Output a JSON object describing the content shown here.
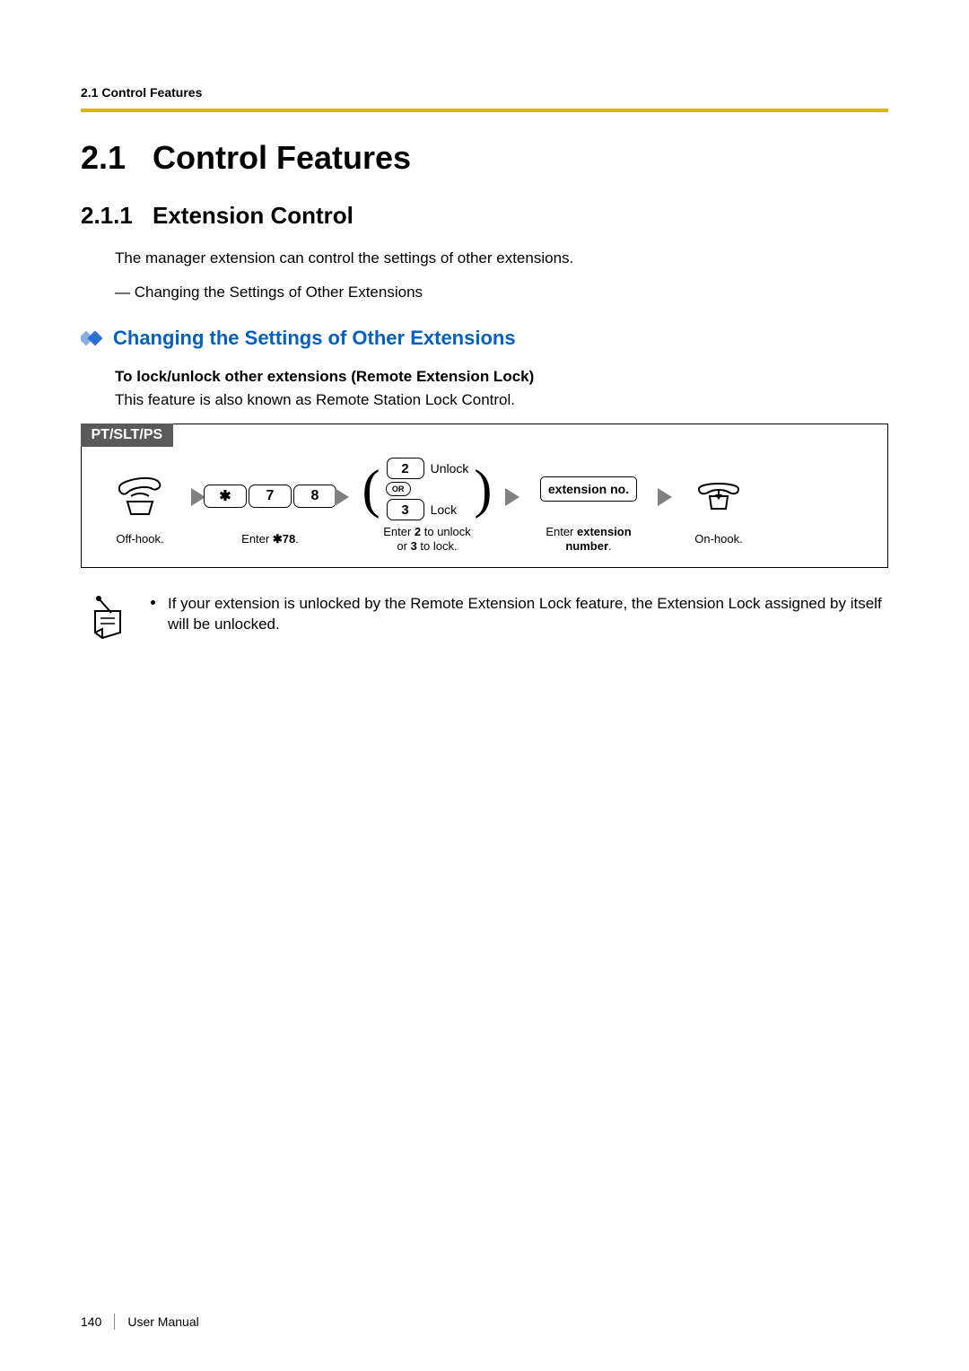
{
  "header": {
    "running": "2.1 Control Features"
  },
  "h1": {
    "num": "2.1",
    "title": "Control Features"
  },
  "h2": {
    "num": "2.1.1",
    "title": "Extension Control"
  },
  "intro": "The manager extension can control the settings of other extensions.",
  "dash": "— Changing the Settings of Other Extensions",
  "blue_heading": "Changing the Settings of Other Extensions",
  "sub_bold": "To lock/unlock other extensions (Remote Extension Lock)",
  "sub_plain": "This feature is also known as Remote Station Lock Control.",
  "proc": {
    "tab": "PT/SLT/PS",
    "steps": {
      "offhook": "Off-hook.",
      "enter78_keys": {
        "star": "✱",
        "k7": "7",
        "k8": "8"
      },
      "enter78_prefix": "Enter ",
      "enter78_code": "✱78",
      "enter78_suffix": ".",
      "choice": {
        "k2": "2",
        "unlock": "Unlock",
        "or": "OR",
        "k3": "3",
        "lock": "Lock"
      },
      "choice_cap_l1_a": "Enter ",
      "choice_cap_l1_b": "2",
      "choice_cap_l1_c": " to unlock",
      "choice_cap_l2_a": "or ",
      "choice_cap_l2_b": "3",
      "choice_cap_l2_c": " to lock.",
      "ext_key": "extension no.",
      "ext_cap_l1_a": "Enter ",
      "ext_cap_l1_b": "extension",
      "ext_cap_l2_a": "number",
      "ext_cap_l2_b": ".",
      "onhook": "On-hook."
    }
  },
  "note": "If your extension is unlocked by the Remote Extension Lock feature, the Extension Lock assigned by itself will be unlocked.",
  "footer": {
    "page": "140",
    "label": "User Manual"
  }
}
